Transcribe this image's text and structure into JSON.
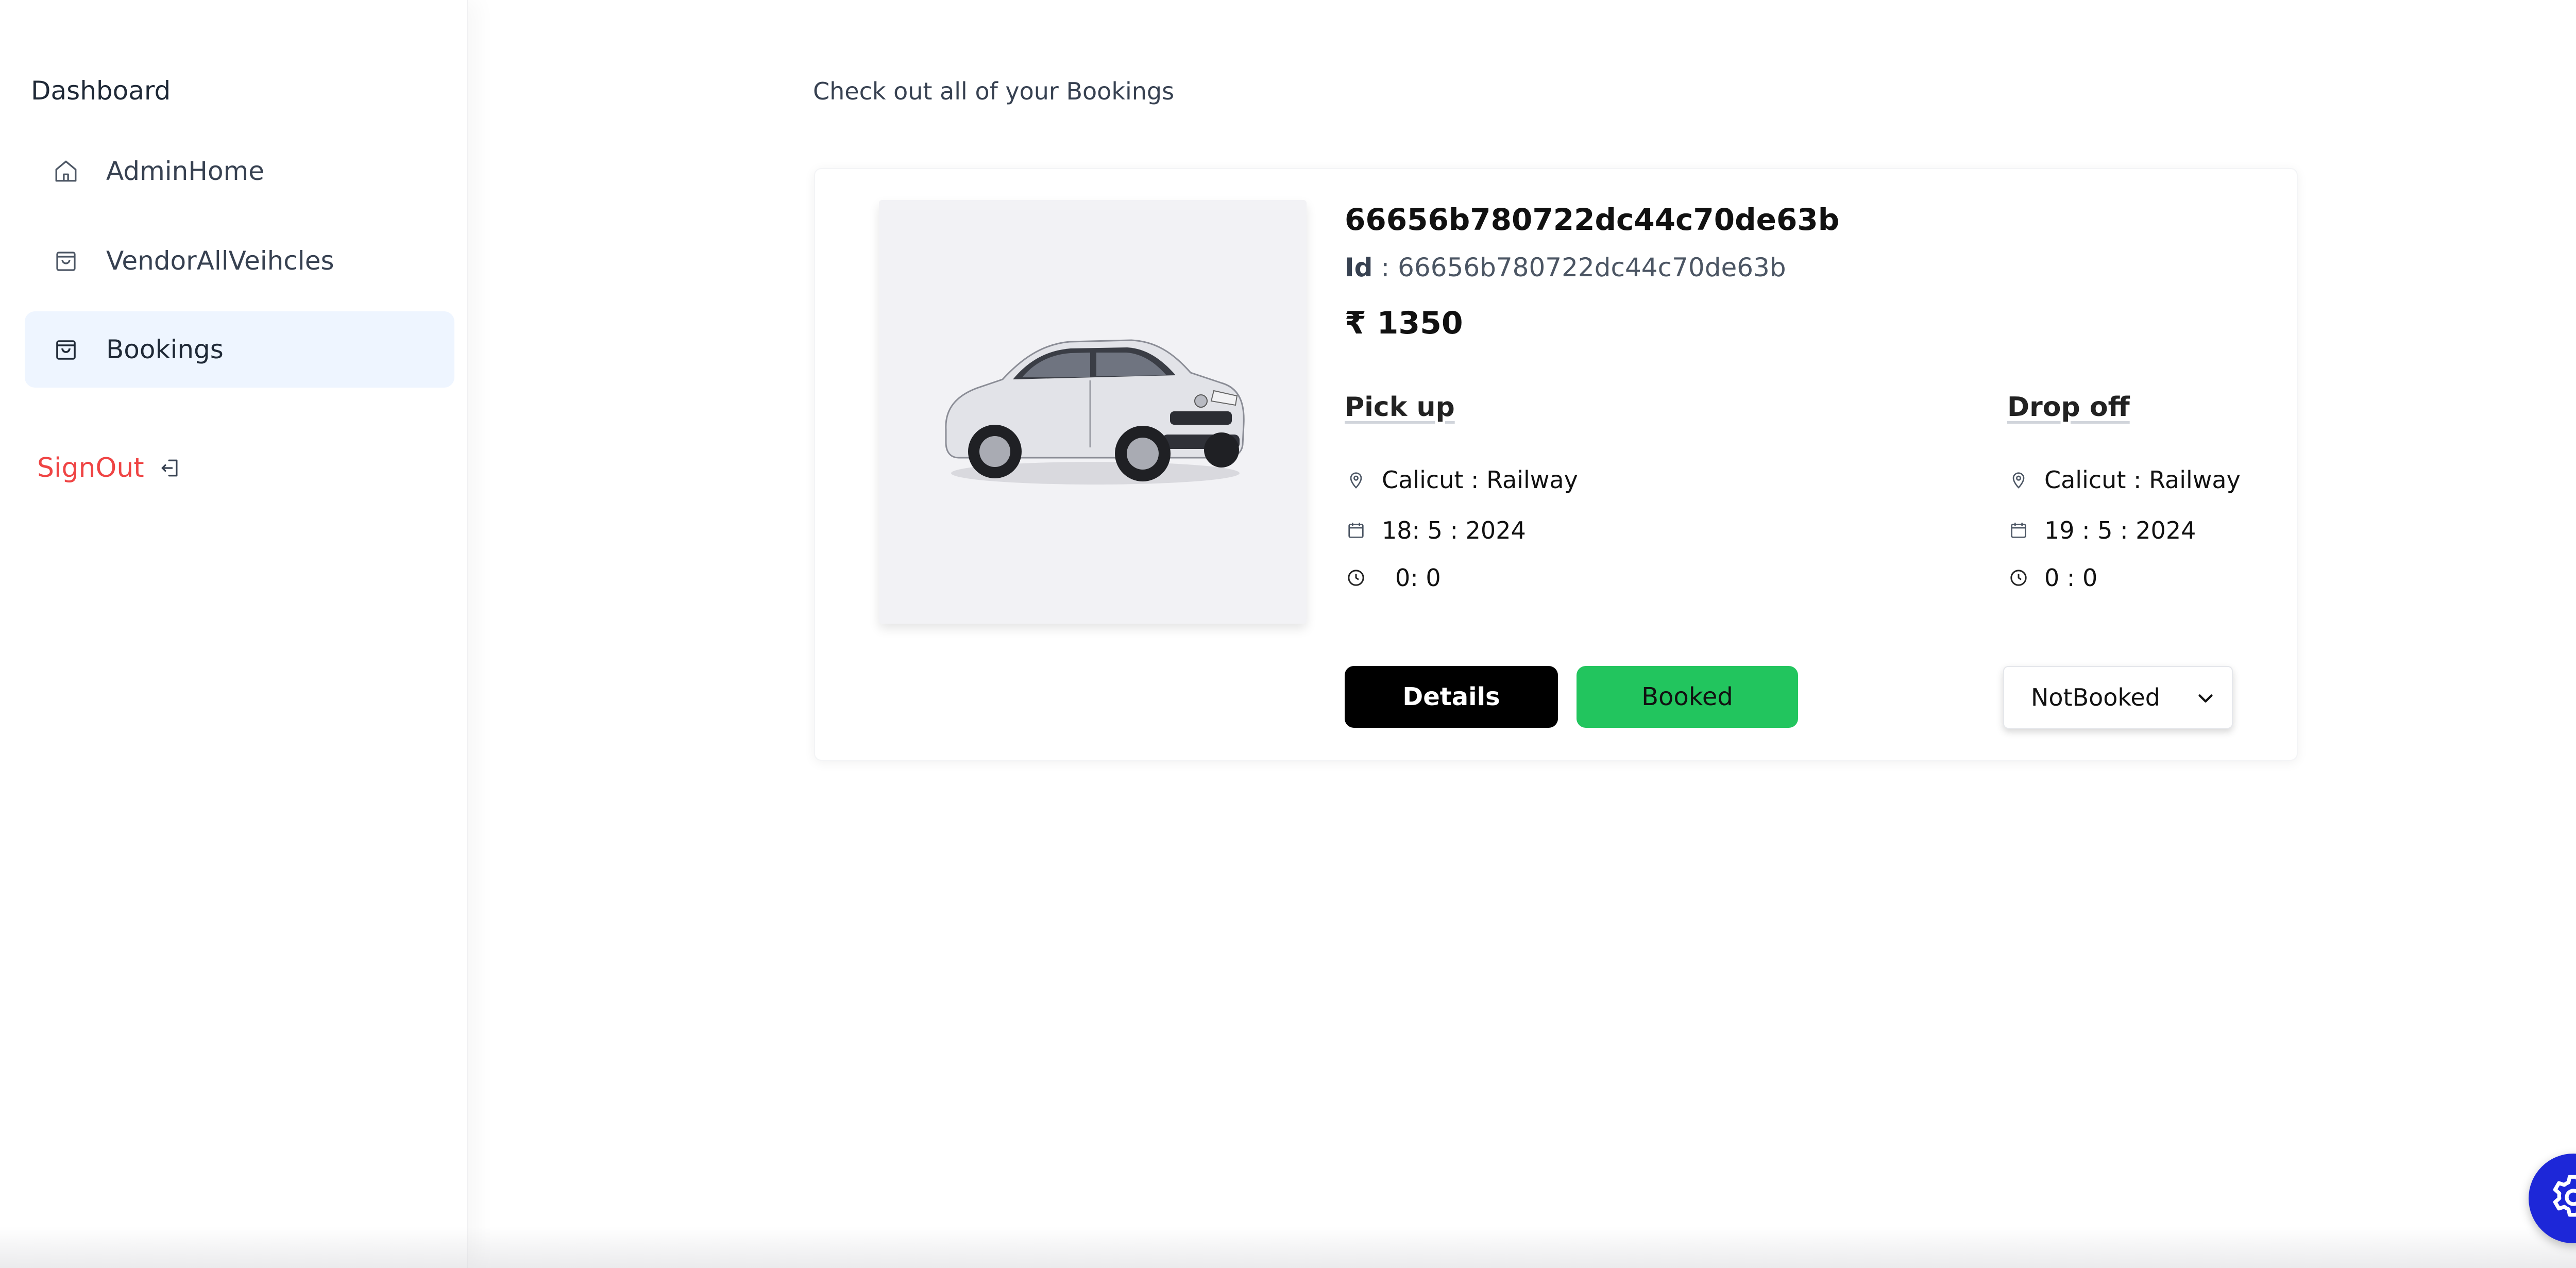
{
  "sidebar": {
    "section_title": "Dashboard",
    "items": [
      {
        "label": "AdminHome",
        "icon": "home-icon"
      },
      {
        "label": "VendorAllVeihcles",
        "icon": "bag-icon"
      },
      {
        "label": "Bookings",
        "icon": "bag-icon",
        "active": true
      }
    ],
    "signout_label": "SignOut",
    "signout_icon": "sign-out-icon"
  },
  "main": {
    "title": "Check out all of your Bookings",
    "booking": {
      "title": "66656b780722dc44c70de63b",
      "id_label": "Id",
      "id_separator": ":",
      "id_value": "66656b780722dc44c70de63b",
      "currency_symbol": "₹",
      "price": "1350",
      "pickup": {
        "heading": "Pick up",
        "location": "Calicut : Railway",
        "date": "18:  5 :  2024",
        "time": "0:  0"
      },
      "dropoff": {
        "heading": "Drop off",
        "location": "Calicut : Railway",
        "date": "19 :  5 :  2024",
        "time": "0  :  0"
      },
      "details_label": "Details",
      "booked_label": "Booked",
      "status_select_value": "NotBooked"
    }
  },
  "colors": {
    "accent_red": "#ef4444",
    "booked_green": "#22c55e",
    "active_nav_bg": "#eef5ff",
    "fab_blue": "#1d27d8"
  }
}
